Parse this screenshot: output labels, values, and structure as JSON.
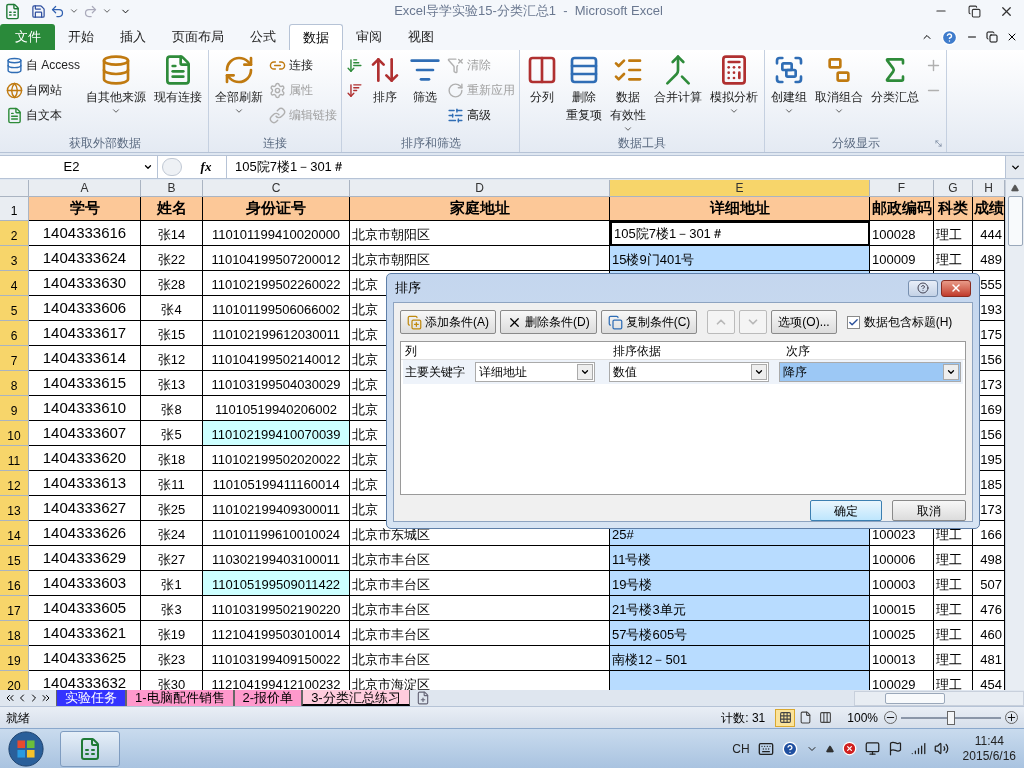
{
  "window": {
    "title": "Excel导学实验15-分类汇总1  -  Microsoft Excel"
  },
  "tabs": [
    {
      "label": "文件",
      "kind": "file",
      "selected": false
    },
    {
      "label": "开始",
      "kind": "tab",
      "selected": false
    },
    {
      "label": "插入",
      "kind": "tab",
      "selected": false
    },
    {
      "label": "页面布局",
      "kind": "tab",
      "selected": false
    },
    {
      "label": "公式",
      "kind": "tab",
      "selected": false
    },
    {
      "label": "数据",
      "kind": "tab",
      "selected": true
    },
    {
      "label": "审阅",
      "kind": "tab",
      "selected": false
    },
    {
      "label": "视图",
      "kind": "tab",
      "selected": false
    }
  ],
  "ribbon": {
    "groups": [
      {
        "label": "获取外部数据",
        "items": [
          {
            "kind": "stack",
            "items": [
              {
                "label": "自 Access",
                "disabled": false
              },
              {
                "label": "自网站",
                "disabled": false
              },
              {
                "label": "自文本",
                "disabled": false
              }
            ]
          },
          {
            "kind": "large",
            "label": "自其他来源",
            "dropdown": true
          },
          {
            "kind": "large",
            "label": "现有连接",
            "dropdown": false
          }
        ]
      },
      {
        "label": "连接",
        "items": [
          {
            "kind": "large",
            "label": "全部刷新",
            "dropdown": true
          },
          {
            "kind": "stack",
            "items": [
              {
                "label": "连接",
                "disabled": false
              },
              {
                "label": "属性",
                "disabled": true
              },
              {
                "label": "编辑链接",
                "disabled": true
              }
            ]
          }
        ]
      },
      {
        "label": "排序和筛选",
        "items": [
          {
            "kind": "stack",
            "items": [
              {
                "disabled": false
              },
              {
                "disabled": false
              }
            ]
          },
          {
            "kind": "large",
            "label": "排序",
            "dropdown": false
          },
          {
            "kind": "large",
            "label": "筛选",
            "dropdown": false
          },
          {
            "kind": "stack",
            "items": [
              {
                "label": "清除",
                "disabled": true
              },
              {
                "label": "重新应用",
                "disabled": true
              },
              {
                "label": "高级",
                "disabled": false
              }
            ]
          }
        ]
      },
      {
        "label": "数据工具",
        "items": [
          {
            "kind": "large",
            "label": "分列",
            "dropdown": false
          },
          {
            "kind": "large",
            "lines": [
              "删除",
              "重复项"
            ],
            "dropdown": false
          },
          {
            "kind": "large",
            "lines": [
              "数据",
              "有效性"
            ],
            "dropdown": true
          },
          {
            "kind": "large",
            "label": "合并计算",
            "dropdown": false
          },
          {
            "kind": "large",
            "label": "模拟分析",
            "dropdown": true
          }
        ]
      },
      {
        "label": "分级显示",
        "launcher": true,
        "items": [
          {
            "kind": "large",
            "label": "创建组",
            "dropdown": true
          },
          {
            "kind": "large",
            "label": "取消组合",
            "dropdown": true
          },
          {
            "kind": "large",
            "label": "分类汇总",
            "dropdown": false
          },
          {
            "kind": "stack",
            "items": [
              {
                "disabled": true
              },
              {
                "disabled": true
              }
            ]
          }
        ]
      }
    ]
  },
  "formula_bar": {
    "name_box": "E2",
    "fx": "fx",
    "value": "105院7楼1－301＃"
  },
  "sheet": {
    "columns": [
      {
        "label": "A",
        "selected": false
      },
      {
        "label": "B",
        "selected": false
      },
      {
        "label": "C",
        "selected": false
      },
      {
        "label": "D",
        "selected": false
      },
      {
        "label": "E",
        "selected": true
      },
      {
        "label": "F",
        "selected": false
      },
      {
        "label": "G",
        "selected": false
      },
      {
        "label": "H",
        "selected": false
      }
    ],
    "header_row": {
      "row": "1",
      "cells": [
        "学号",
        "姓名",
        "身份证号",
        "家庭地址",
        "详细地址",
        "邮政编码",
        "科类",
        "成绩"
      ]
    },
    "rows": [
      {
        "row": "2",
        "selected": true,
        "active": true,
        "highlighted": false,
        "cells": {
          "A": "1404333616",
          "B": "张14",
          "C": "110101199410020000",
          "D": "北京市朝阳区",
          "E": "105院7楼1－301＃",
          "F": "100028",
          "G": "理工",
          "H": "444"
        }
      },
      {
        "row": "3",
        "selected": true,
        "active": false,
        "highlighted": false,
        "cells": {
          "A": "1404333624",
          "B": "张22",
          "C": "110104199507200012",
          "D": "北京市朝阳区",
          "E": "15楼9门401号",
          "F": "100009",
          "G": "理工",
          "H": "489"
        }
      },
      {
        "row": "4",
        "selected": true,
        "highlighted": false,
        "cells": {
          "A": "1404333630",
          "B": "张28",
          "C": "110102199502260022",
          "D": "北京",
          "H": "555"
        }
      },
      {
        "row": "5",
        "selected": true,
        "highlighted": false,
        "cells": {
          "A": "1404333606",
          "B": "张4",
          "C": "110101199506066002",
          "D": "北京",
          "H": "193"
        }
      },
      {
        "row": "6",
        "selected": true,
        "highlighted": false,
        "cells": {
          "A": "1404333617",
          "B": "张15",
          "C": "110102199612030011",
          "D": "北京",
          "H": "175"
        }
      },
      {
        "row": "7",
        "selected": true,
        "highlighted": false,
        "cells": {
          "A": "1404333614",
          "B": "张12",
          "C": "110104199502140012",
          "D": "北京",
          "H": "156"
        }
      },
      {
        "row": "8",
        "selected": true,
        "highlighted": false,
        "cells": {
          "A": "1404333615",
          "B": "张13",
          "C": "110103199504030029",
          "D": "北京",
          "H": "173"
        }
      },
      {
        "row": "9",
        "selected": true,
        "highlighted": false,
        "cells": {
          "A": "1404333610",
          "B": "张8",
          "C": "11010519940206002",
          "D": "北京",
          "H": "169"
        }
      },
      {
        "row": "10",
        "selected": true,
        "highlighted": true,
        "cells": {
          "A": "1404333607",
          "B": "张5",
          "C": "110102199410070039",
          "D": "北京",
          "H": "156"
        }
      },
      {
        "row": "11",
        "selected": true,
        "highlighted": false,
        "cells": {
          "A": "1404333620",
          "B": "张18",
          "C": "110102199502020022",
          "D": "北京",
          "H": "195"
        }
      },
      {
        "row": "12",
        "selected": true,
        "highlighted": false,
        "cells": {
          "A": "1404333613",
          "B": "张11",
          "C": "110105199411160014",
          "D": "北京",
          "H": "185"
        }
      },
      {
        "row": "13",
        "selected": true,
        "highlighted": false,
        "cells": {
          "A": "1404333627",
          "B": "张25",
          "C": "110102199409300011",
          "D": "北京",
          "H": "173"
        }
      },
      {
        "row": "14",
        "selected": true,
        "active": false,
        "highlighted": false,
        "cells": {
          "A": "1404333626",
          "B": "张24",
          "C": "110101199610010024",
          "D": "北京市东城区",
          "E": "25#",
          "F": "100023",
          "G": "理工",
          "H": "166"
        }
      },
      {
        "row": "15",
        "selected": true,
        "active": false,
        "highlighted": false,
        "cells": {
          "A": "1404333629",
          "B": "张27",
          "C": "110302199403100011",
          "D": "北京市丰台区",
          "E": "11号楼",
          "F": "100006",
          "G": "理工",
          "H": "498"
        }
      },
      {
        "row": "16",
        "selected": true,
        "active": false,
        "highlighted": true,
        "cells": {
          "A": "1404333603",
          "B": "张1",
          "C": "110105199509011422",
          "D": "北京市丰台区",
          "E": "19号楼",
          "F": "100003",
          "G": "理工",
          "H": "507"
        }
      },
      {
        "row": "17",
        "selected": true,
        "active": false,
        "highlighted": false,
        "cells": {
          "A": "1404333605",
          "B": "张3",
          "C": "110103199502190220",
          "D": "北京市丰台区",
          "E": "21号楼3单元",
          "F": "100015",
          "G": "理工",
          "H": "476"
        }
      },
      {
        "row": "18",
        "selected": true,
        "active": false,
        "highlighted": false,
        "cells": {
          "A": "1404333621",
          "B": "张19",
          "C": "112104199503010014",
          "D": "北京市丰台区",
          "E": "57号楼605号",
          "F": "100025",
          "G": "理工",
          "H": "460"
        }
      },
      {
        "row": "19",
        "selected": true,
        "active": false,
        "highlighted": false,
        "cells": {
          "A": "1404333625",
          "B": "张23",
          "C": "110103199409150022",
          "D": "北京市丰台区",
          "E": "南楼12－501",
          "F": "100013",
          "G": "理工",
          "H": "481"
        }
      },
      {
        "row": "20",
        "selected": true,
        "active": false,
        "highlighted": false,
        "cells": {
          "A": "1404333632",
          "B": "张30",
          "C": "112104199412100232",
          "D": "北京市海淀区",
          "F": "100029",
          "G": "理工",
          "H": "454"
        }
      }
    ]
  },
  "dialog": {
    "title": "排序",
    "buttons": [
      {
        "kind": "add",
        "label": "添加条件(A)",
        "disabled": false
      },
      {
        "kind": "delete",
        "label": "删除条件(D)",
        "disabled": false
      },
      {
        "kind": "copy",
        "label": "复制条件(C)",
        "disabled": false
      },
      {
        "kind": "up",
        "disabled": true
      },
      {
        "kind": "down",
        "disabled": true
      },
      {
        "kind": "text",
        "label": "选项(O)...",
        "disabled": false
      }
    ],
    "header_checkbox": {
      "label": "数据包含标题(H)",
      "checked": true
    },
    "columns": [
      "列",
      "排序依据",
      "次序"
    ],
    "levels": [
      {
        "label": "主要关键字",
        "column": "详细地址",
        "sort_on": "数值",
        "order": "降序",
        "selected": true
      }
    ],
    "ok": "确定",
    "cancel": "取消"
  },
  "sheet_tabs": [
    {
      "label": "实验任务",
      "color": "#3333ff",
      "selected": false
    },
    {
      "label": "1-电脑配件销售",
      "color": "#ff99cc",
      "selected": false
    },
    {
      "label": "2-报价单",
      "color": "#ff99cc",
      "selected": false
    },
    {
      "label": "3-分类汇总练习",
      "color": "#ffccdd",
      "selected": true
    }
  ],
  "status": {
    "ready": "就绪",
    "count": "计数: 31",
    "views": [
      {
        "selected": true
      },
      {
        "selected": false
      },
      {
        "selected": false
      }
    ],
    "zoom": "100%",
    "level": 0.5
  },
  "taskbar": {
    "lang": "CH",
    "time": "11:44",
    "date": "2015/6/16"
  }
}
